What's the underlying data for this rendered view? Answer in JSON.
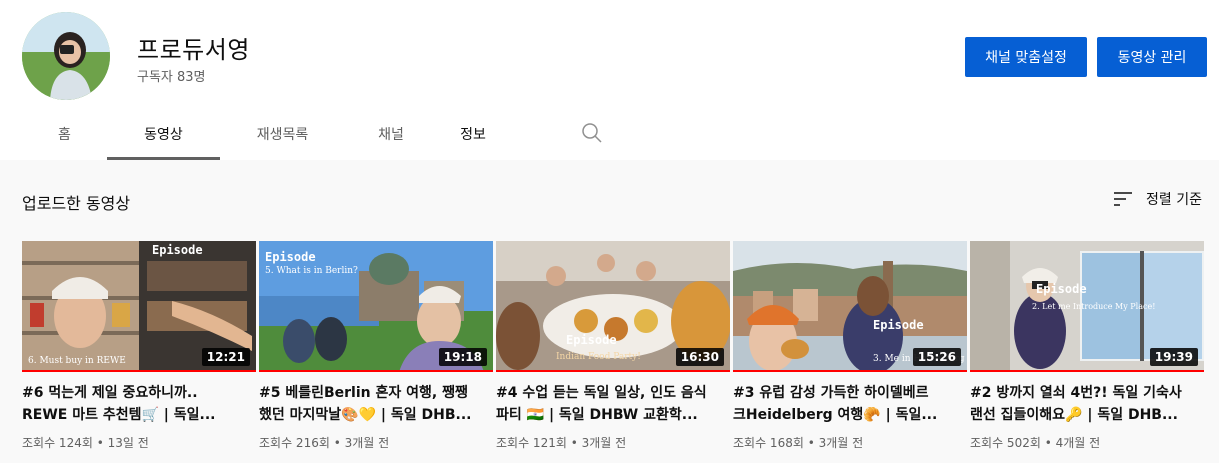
{
  "channel": {
    "name": "프로듀서영",
    "subscribers": "구독자 83명",
    "customize_label": "채널 맞춤설정",
    "manage_label": "동영상 관리"
  },
  "tabs": [
    {
      "label": "홈"
    },
    {
      "label": "동영상"
    },
    {
      "label": "재생목록"
    },
    {
      "label": "채널"
    },
    {
      "label": "정보"
    }
  ],
  "active_tab": "동영상",
  "section": {
    "title": "업로드한 동영상",
    "sort_label": "정렬 기준"
  },
  "videos": [
    {
      "title_line1": "#6 먹는게 제일 중요하니까..",
      "title_line2": "REWE 마트 추천템🛒 | 독일...",
      "duration": "12:21",
      "meta": "조회수 124회 • 13일 전",
      "overlay_caption": "6. Must buy in REWE",
      "watermark": "Episode"
    },
    {
      "title_line1": "#5 베를린Berlin 혼자 여행, 쨍쨍",
      "title_line2": "했던 마지막날🎨💛 | 독일 DHB...",
      "duration": "19:18",
      "meta": "조회수 216회 • 3개월 전",
      "overlay_caption": "5. What is in Berlin?",
      "watermark": "Episode"
    },
    {
      "title_line1": "#4 수업 듣는 독일 일상, 인도 음식",
      "title_line2": "파티 🇮🇳 | 독일 DHBW 교환학...",
      "duration": "16:30",
      "meta": "조회수 121회 • 3개월 전",
      "overlay_caption": "Indian Food Party!",
      "watermark": "Episode"
    },
    {
      "title_line1": "#3 유럽 감성 가득한 하이델베르",
      "title_line2": "크Heidelberg 여행🥐 | 독일...",
      "duration": "15:26",
      "meta": "조회수 168회 • 3개월 전",
      "overlay_caption": "3. Me in Heidelberg",
      "watermark": "Episode"
    },
    {
      "title_line1": "#2 방까지 열쇠 4번?! 독일 기숙사",
      "title_line2": "랜선 집들이해요🔑 | 독일 DHB...",
      "duration": "19:39",
      "meta": "조회수 502회 • 4개월 전",
      "overlay_caption": "2. Let me Introduce My Place!",
      "watermark": "Episode"
    }
  ],
  "colors": {
    "accent": "#065fd4",
    "text_primary": "#0f0f0f",
    "text_secondary": "#606060",
    "page_bg": "#f9f9f9",
    "progress_red": "#ff0000"
  }
}
